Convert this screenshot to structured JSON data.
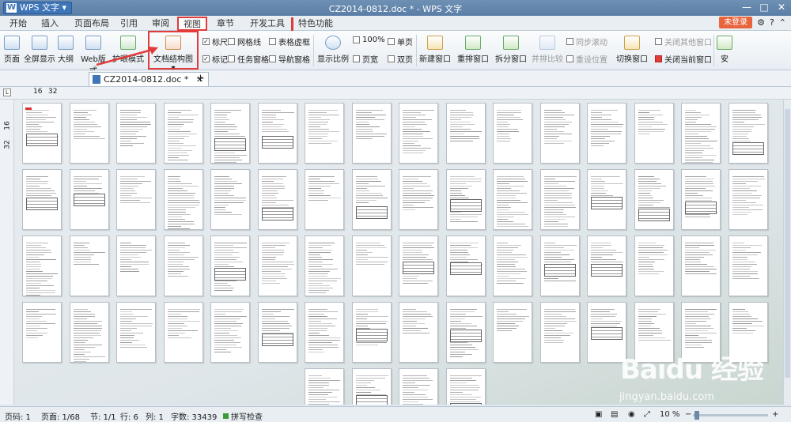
{
  "titlebar": {
    "app_label": "WPS 文字",
    "doc_title": "CZ2014-0812.doc * - WPS 文字",
    "min": "—",
    "max": "□",
    "close": "✕"
  },
  "menu_tabs": [
    "开始",
    "插入",
    "页面布局",
    "引用",
    "审阅",
    "视图",
    "章节",
    "开发工具",
    "特色功能"
  ],
  "active_tab": "视图",
  "tabbar_right": {
    "login": "未登录"
  },
  "ribbon": {
    "buttons": [
      {
        "label": "页面"
      },
      {
        "label": "全屏显示"
      },
      {
        "label": "大纲"
      },
      {
        "label": "Web版式"
      },
      {
        "label": "护眼模式"
      },
      {
        "label": "文档结构图"
      }
    ],
    "checkboxes": [
      {
        "label": "标尺",
        "checked": true
      },
      {
        "label": "网格线",
        "checked": false
      },
      {
        "label": "表格虚框",
        "checked": false
      },
      {
        "label": "标记",
        "checked": true
      },
      {
        "label": "任务窗格",
        "checked": false
      },
      {
        "label": "导航窗格",
        "checked": false
      }
    ],
    "zoom": {
      "show_ratio": "显示比例",
      "percent": "100%",
      "single": "单页",
      "page_width": "页宽",
      "double": "双页"
    },
    "windows": {
      "new_window": "新建窗口",
      "rearrange": "重排窗口",
      "split": "拆分窗口",
      "side_by_side": "并排比较",
      "sync_scroll": "同步滚动",
      "reset_pos": "重设位置",
      "switch": "切换窗口",
      "close_others": "关闭其他窗口",
      "close_current": "关闭当前窗口",
      "macro": "安"
    }
  },
  "doc_tabs": [
    {
      "label": "CZ2014-0812.doc *"
    }
  ],
  "ruler": {
    "marks": [
      "16",
      "32"
    ],
    "vmarks": [
      "16",
      "32"
    ]
  },
  "status": {
    "page": "页码: 1",
    "pages": "页面: 1/68",
    "section": "节: 1/1",
    "row": "行: 6",
    "col": "列: 1",
    "words": "字数: 33439",
    "spell": "拼写检查",
    "zoom": "10 %"
  },
  "watermark": {
    "brand": "Baidu 经验",
    "url": "jingyan.baidu.com"
  },
  "thumbnails": {
    "count": 68
  }
}
